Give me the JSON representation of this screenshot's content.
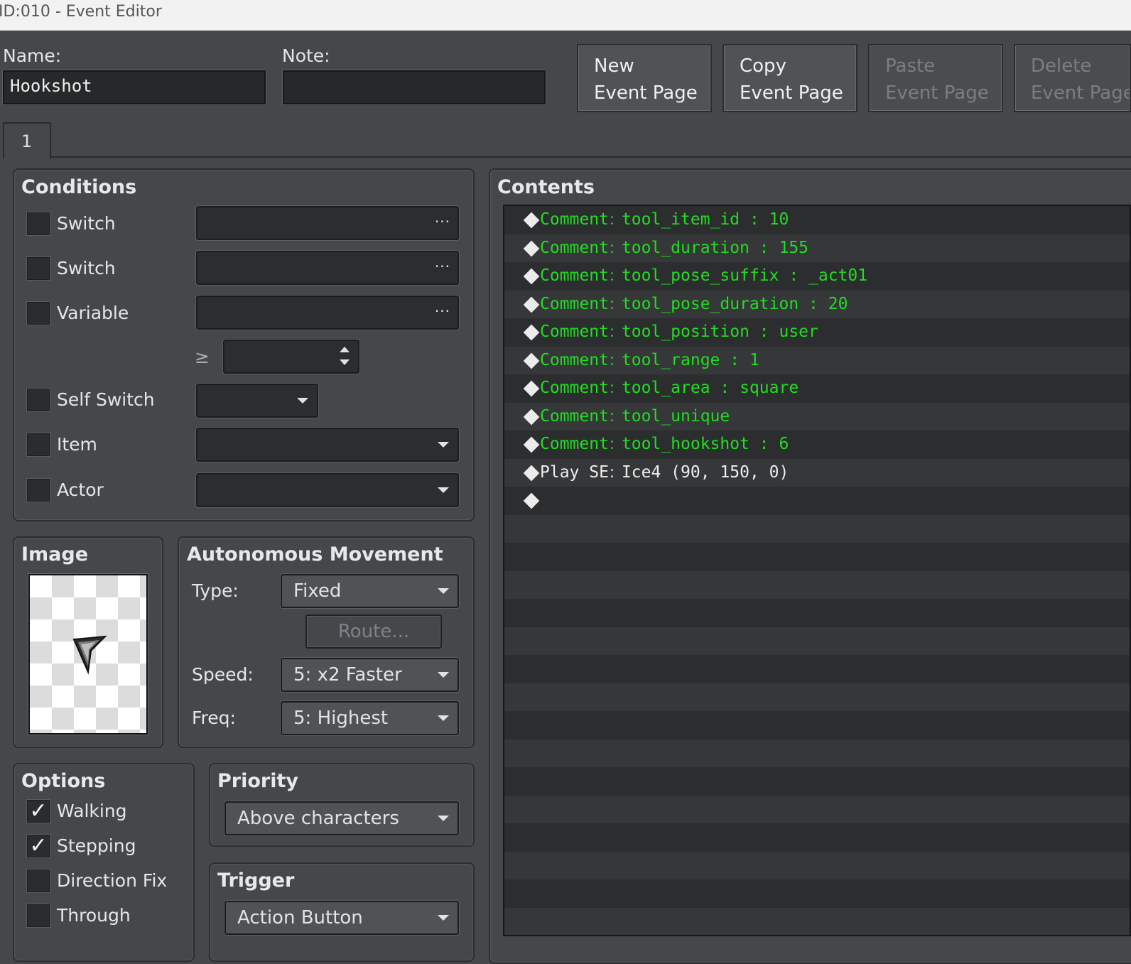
{
  "window": {
    "title": "ID:010 - Event Editor"
  },
  "header": {
    "name_label": "Name:",
    "name_value": "Hookshot",
    "note_label": "Note:",
    "note_value": "",
    "buttons": [
      {
        "line1": "New",
        "line2": "Event Page",
        "enabled": true
      },
      {
        "line1": "Copy",
        "line2": "Event Page",
        "enabled": true
      },
      {
        "line1": "Paste",
        "line2": "Event Page",
        "enabled": false
      },
      {
        "line1": "Delete",
        "line2": "Event Page",
        "enabled": false
      }
    ]
  },
  "tabs": [
    {
      "label": "1",
      "selected": true
    }
  ],
  "conditions": {
    "title": "Conditions",
    "switch1_label": "Switch",
    "switch2_label": "Switch",
    "variable_label": "Variable",
    "compare_symbol": "≥",
    "self_switch_label": "Self Switch",
    "item_label": "Item",
    "actor_label": "Actor",
    "ellipsis": "···"
  },
  "image": {
    "title": "Image",
    "icon": "arrow-cursor-sprite"
  },
  "movement": {
    "title": "Autonomous Movement",
    "type_label": "Type:",
    "type_value": "Fixed",
    "route_label": "Route...",
    "speed_label": "Speed:",
    "speed_value": "5: x2 Faster",
    "freq_label": "Freq:",
    "freq_value": "5: Highest"
  },
  "options": {
    "title": "Options",
    "items": [
      {
        "label": "Walking",
        "checked": true
      },
      {
        "label": "Stepping",
        "checked": true
      },
      {
        "label": "Direction Fix",
        "checked": false
      },
      {
        "label": "Through",
        "checked": false
      }
    ]
  },
  "priority": {
    "title": "Priority",
    "value": "Above characters"
  },
  "trigger": {
    "title": "Trigger",
    "value": "Action Button"
  },
  "contents": {
    "title": "Contents",
    "commands": [
      {
        "cmd": "Comment",
        "arg": "tool_item_id : 10",
        "color": "#22dd22"
      },
      {
        "cmd": "Comment",
        "arg": "tool_duration : 155",
        "color": "#22dd22"
      },
      {
        "cmd": "Comment",
        "arg": "tool_pose_suffix : _act01",
        "color": "#22dd22"
      },
      {
        "cmd": "Comment",
        "arg": "tool_pose_duration : 20",
        "color": "#22dd22"
      },
      {
        "cmd": "Comment",
        "arg": "tool_position : user",
        "color": "#22dd22"
      },
      {
        "cmd": "Comment",
        "arg": "tool_range : 1",
        "color": "#22dd22"
      },
      {
        "cmd": "Comment",
        "arg": "tool_area : square",
        "color": "#22dd22"
      },
      {
        "cmd": "Comment",
        "arg": "tool_unique",
        "color": "#22dd22"
      },
      {
        "cmd": "Comment",
        "arg": "tool_hookshot : 6",
        "color": "#22dd22"
      },
      {
        "cmd": "Play SE",
        "arg": "Ice4 (90, 150, 0)",
        "color": "#eeeeee"
      },
      {
        "cmd": "",
        "arg": "",
        "color": "#eeeeee"
      }
    ],
    "separator": "："
  }
}
